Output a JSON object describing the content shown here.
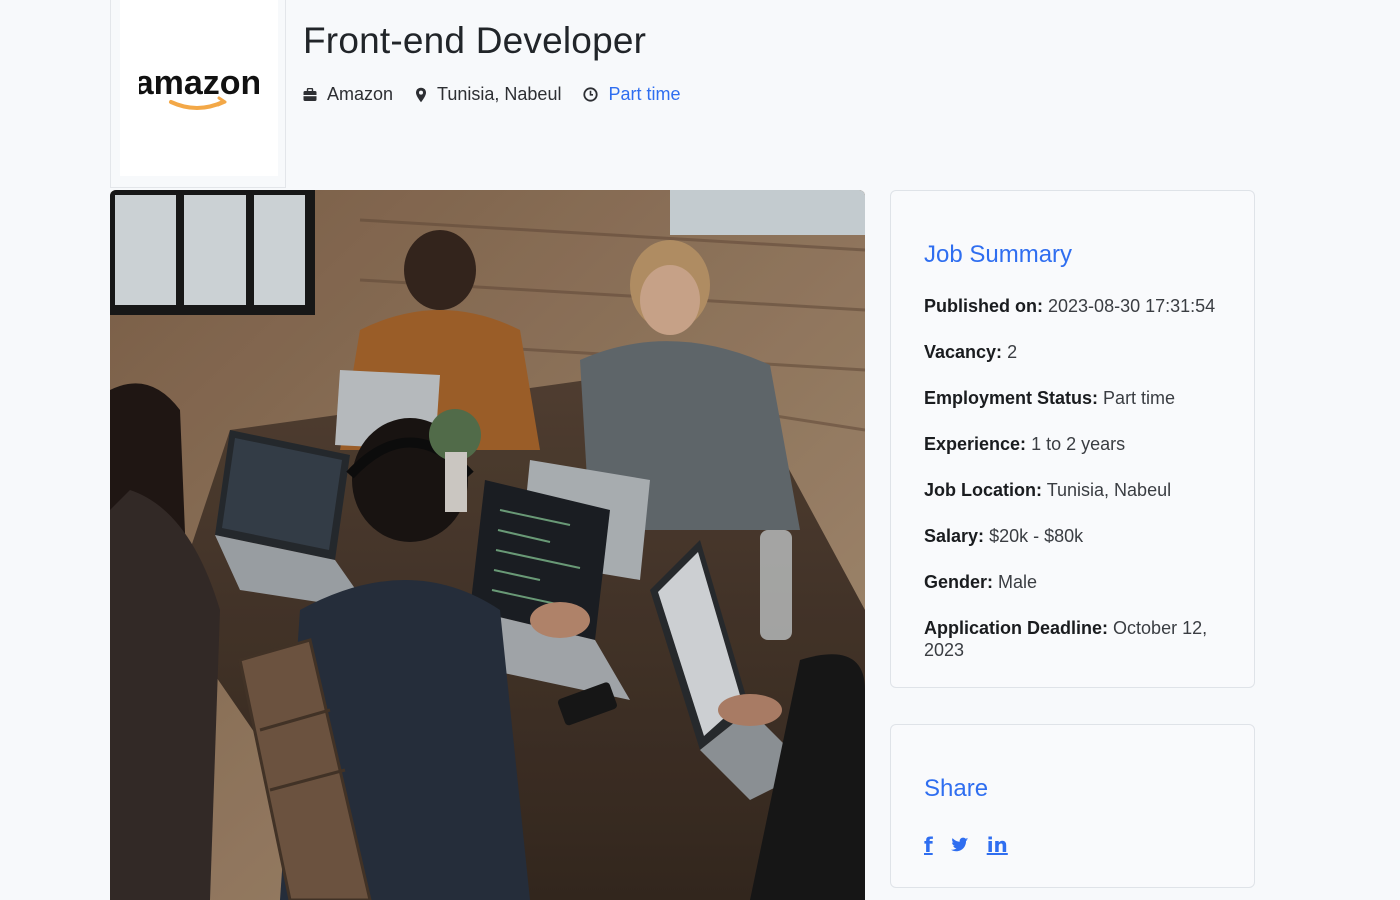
{
  "company": {
    "logo_text": "amazon",
    "name": "Amazon"
  },
  "job": {
    "title": "Front-end Developer",
    "location": "Tunisia, Nabeul",
    "type": "Part time"
  },
  "summary": {
    "title": "Job Summary",
    "items": [
      {
        "label": "Published on:",
        "value": "2023-08-30 17:31:54"
      },
      {
        "label": "Vacancy:",
        "value": "2"
      },
      {
        "label": "Employment Status:",
        "value": "Part time"
      },
      {
        "label": "Experience:",
        "value": "1 to 2 years"
      },
      {
        "label": "Job Location:",
        "value": "Tunisia, Nabeul"
      },
      {
        "label": "Salary:",
        "value": "$20k - $80k"
      },
      {
        "label": "Gender:",
        "value": "Male"
      },
      {
        "label": "Application Deadline:",
        "value": "October 12, 2023"
      }
    ]
  },
  "share": {
    "title": "Share",
    "links": [
      {
        "icon": "facebook-icon",
        "glyph": "f"
      },
      {
        "icon": "twitter-icon",
        "glyph": "t"
      },
      {
        "icon": "linkedin-icon",
        "glyph": "in"
      }
    ]
  },
  "colors": {
    "accent": "#2f6ef0",
    "background": "#f7f9fb"
  }
}
